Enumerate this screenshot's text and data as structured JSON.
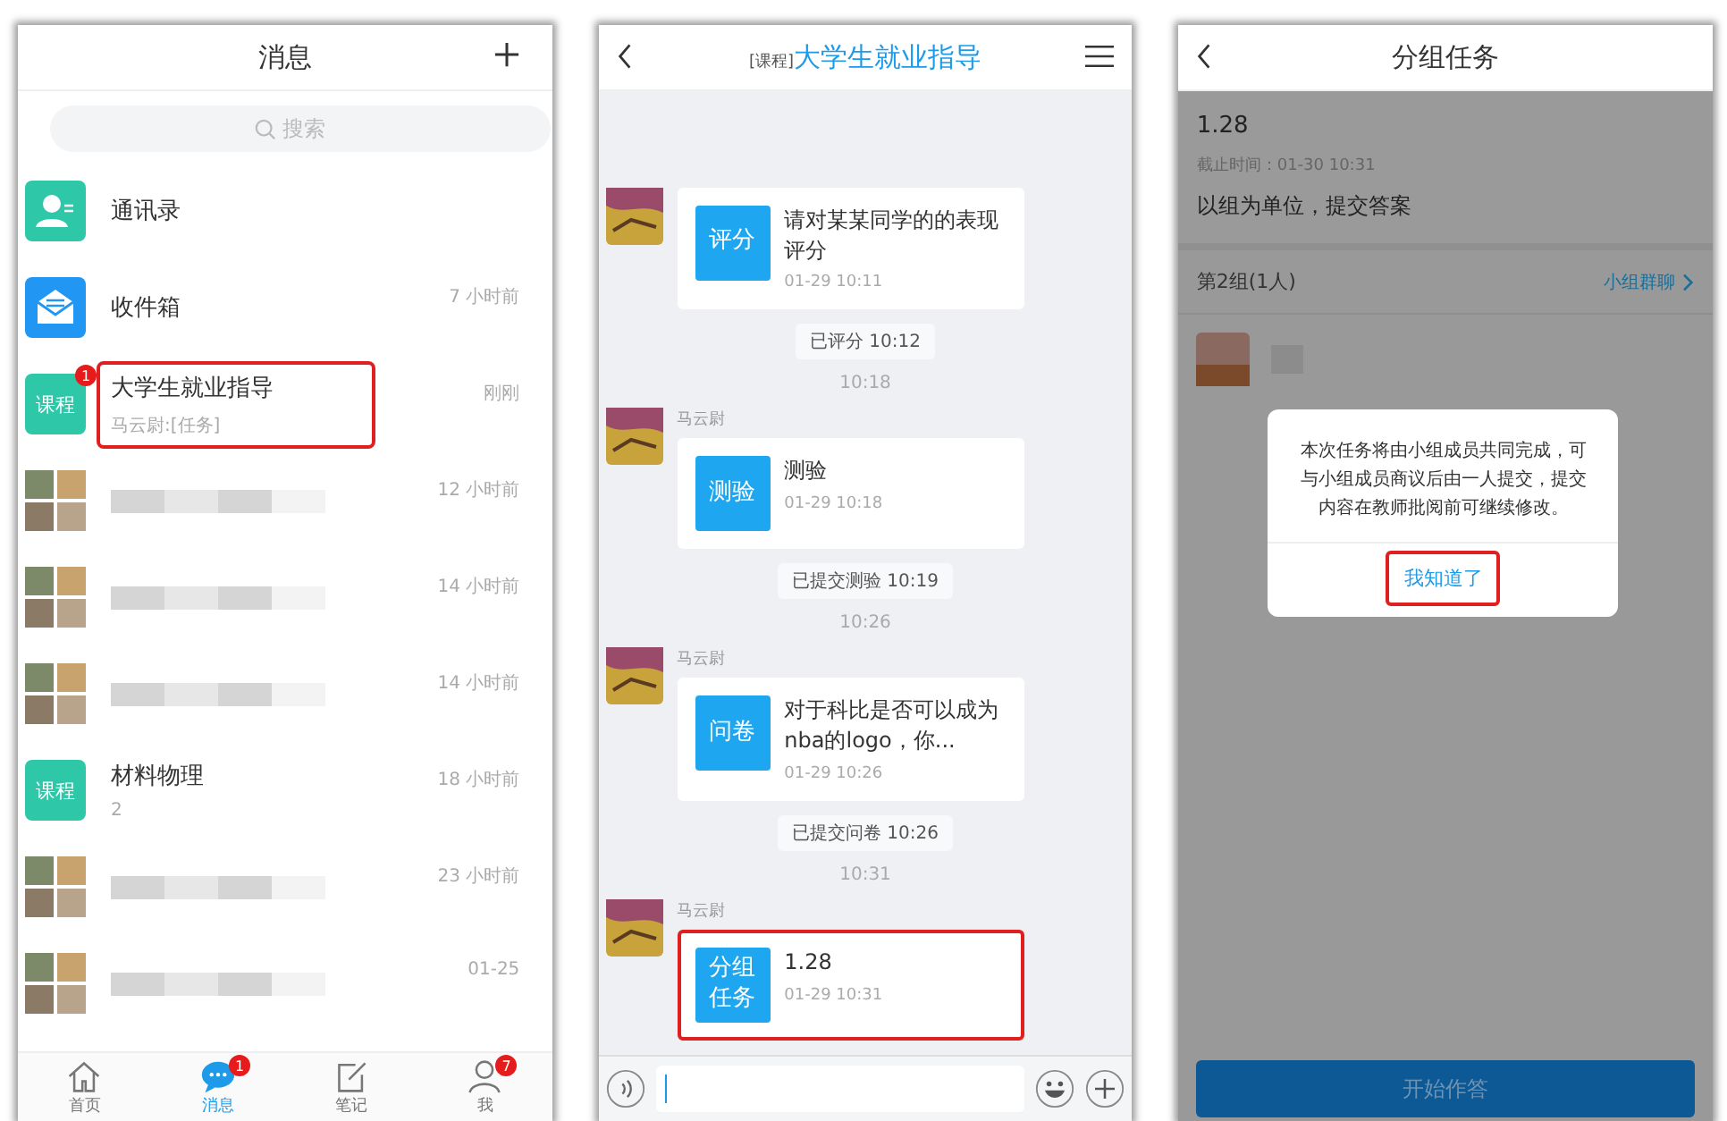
{
  "messages_screen": {
    "title": "消息",
    "search": {
      "placeholder": "搜索"
    },
    "conversations": [
      {
        "kind": "contacts",
        "name": "通讯录",
        "highlighted": false
      },
      {
        "kind": "inbox",
        "name": "收件箱",
        "time": "7 小时前",
        "highlighted": false
      },
      {
        "kind": "course",
        "avatar_label": "课程",
        "name": "大学生就业指导",
        "preview": "马云尉:[任务]",
        "time": "刚刚",
        "badge": "1",
        "highlighted": true
      },
      {
        "kind": "group",
        "time": "12 小时前",
        "highlighted": false
      },
      {
        "kind": "group",
        "time": "14 小时前",
        "highlighted": false
      },
      {
        "kind": "group",
        "time": "14 小时前",
        "highlighted": false
      },
      {
        "kind": "course",
        "avatar_label": "课程",
        "name": "材料物理",
        "preview": "2",
        "time": "18 小时前",
        "highlighted": false
      },
      {
        "kind": "group",
        "time": "23 小时前",
        "highlighted": false
      },
      {
        "kind": "group",
        "time": "01-25",
        "highlighted": false
      }
    ],
    "nav": [
      {
        "kind": "home",
        "label": "首页",
        "selected": false
      },
      {
        "kind": "chat",
        "label": "消息",
        "selected": true,
        "badge": "1"
      },
      {
        "kind": "note",
        "label": "笔记",
        "selected": false
      },
      {
        "kind": "me",
        "label": "我",
        "selected": false,
        "badge": "7"
      }
    ]
  },
  "chat_screen": {
    "title_tag": "[课程]",
    "title": "大学生就业指导",
    "items": [
      {
        "kind": "card",
        "tag": "评分",
        "text": "请对某某同学的的表现评分",
        "time": "01-29 10:11",
        "highlighted": false
      },
      {
        "kind": "notice",
        "text": "已评分 10:12"
      },
      {
        "kind": "time",
        "text": "10:18"
      },
      {
        "kind": "card",
        "sender": "马云尉",
        "tag": "测验",
        "text": "测验",
        "time": "01-29 10:18",
        "highlighted": false
      },
      {
        "kind": "notice",
        "text": "已提交测验 10:19"
      },
      {
        "kind": "time",
        "text": "10:26"
      },
      {
        "kind": "card",
        "sender": "马云尉",
        "tag": "问卷",
        "text": "对于科比是否可以成为nba的logo，你...",
        "time": "01-29 10:26",
        "highlighted": false
      },
      {
        "kind": "notice",
        "text": "已提交问卷 10:26"
      },
      {
        "kind": "time",
        "text": "10:31"
      },
      {
        "kind": "card",
        "sender": "马云尉",
        "tag": "分组任务",
        "text": "1.28",
        "time": "01-29 10:31",
        "highlighted": true
      }
    ]
  },
  "task_screen": {
    "title": "分组任务",
    "task_name": "1.28",
    "deadline": "截止时间：01-30 10:31",
    "description": "以组为单位，提交答案",
    "group": "第2组(1人)",
    "group_chat_link": "小组群聊",
    "dialog": {
      "text": "本次任务将由小组成员共同完成，可与小组成员商议后由一人提交，提交内容在教师批阅前可继续修改。",
      "button": "我知道了",
      "highlighted": true
    },
    "start_button": "开始作答"
  }
}
